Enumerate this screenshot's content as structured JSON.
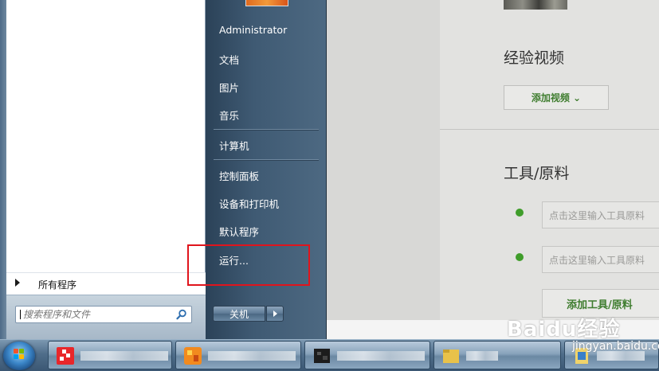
{
  "start_menu": {
    "left_pane": {
      "all_programs_label": "所有程序",
      "search_placeholder": "搜索程序和文件"
    },
    "right_pane": {
      "items": [
        {
          "label": "Administrator"
        },
        {
          "label": "文档"
        },
        {
          "label": "图片"
        },
        {
          "label": "音乐"
        },
        {
          "label": "计算机"
        },
        {
          "label": "控制面板"
        },
        {
          "label": "设备和打印机"
        },
        {
          "label": "默认程序"
        },
        {
          "label": "运行..."
        }
      ],
      "shutdown_label": "关机"
    }
  },
  "background_page": {
    "video_section_title": "经验视频",
    "add_video_button": "添加视频 ⌄",
    "tools_section_title": "工具/原料",
    "tool_input_placeholder": "点击这里输入工具原料",
    "add_tool_button": "添加工具/原料"
  },
  "watermark": {
    "brand": "Baidu经验",
    "url": "jingyan.baidu.com"
  },
  "colors": {
    "highlight": "#e0141c",
    "accent_green": "#3f9d2a",
    "start_menu_right": "#3f5a73"
  },
  "icons": {
    "search": "search-icon",
    "start": "windows-start-orb-icon"
  }
}
